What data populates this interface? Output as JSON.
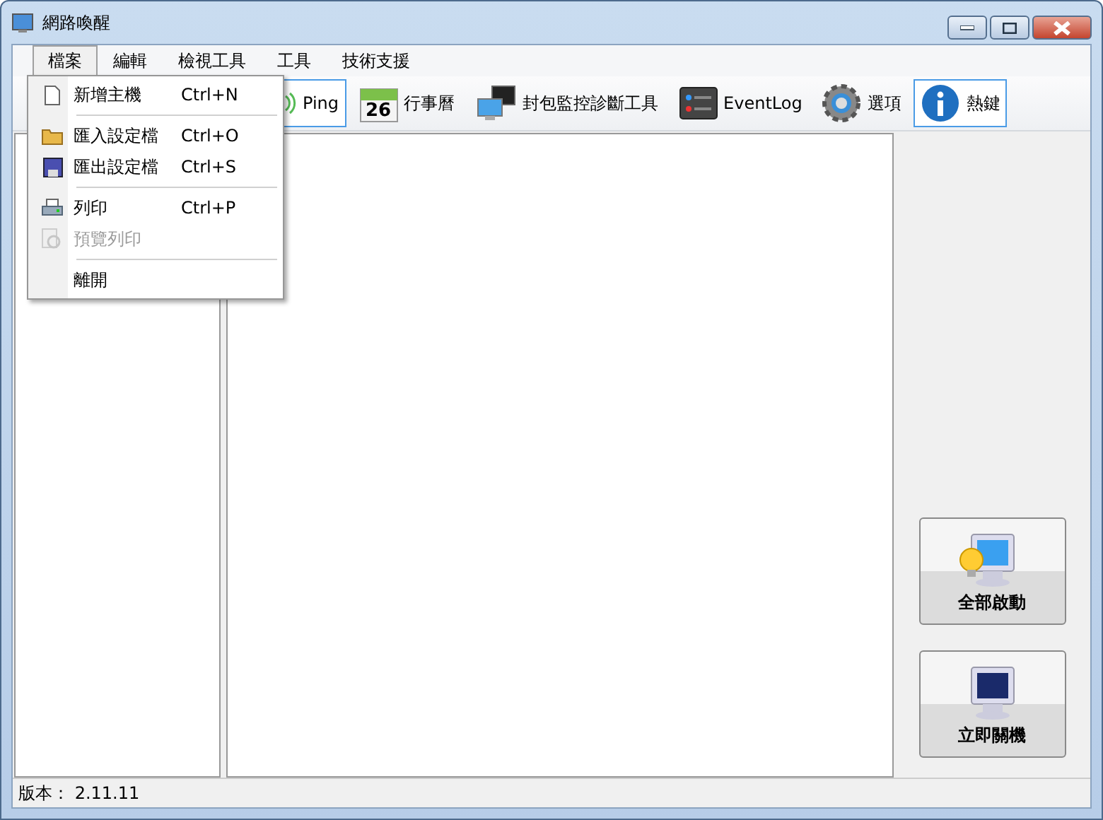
{
  "window": {
    "title": "網路喚醒"
  },
  "menu": [
    {
      "label": "檔案",
      "selected": true
    },
    {
      "label": "編輯",
      "selected": false
    },
    {
      "label": "檢視工具",
      "selected": false
    },
    {
      "label": "工具",
      "selected": false
    },
    {
      "label": "技術支援",
      "selected": false
    }
  ],
  "dropdown": [
    {
      "kind": "item",
      "label": "新增主機",
      "shortcut": "Ctrl+N",
      "disabled": false
    },
    {
      "kind": "separator"
    },
    {
      "kind": "item",
      "label": "匯入設定檔",
      "shortcut": "Ctrl+O",
      "disabled": false
    },
    {
      "kind": "item",
      "label": "匯出設定檔",
      "shortcut": "Ctrl+S",
      "disabled": false
    },
    {
      "kind": "separator"
    },
    {
      "kind": "item",
      "label": "列印",
      "shortcut": "Ctrl+P",
      "disabled": false
    },
    {
      "kind": "item",
      "label": "預覽列印",
      "disabled": true
    },
    {
      "kind": "separator"
    },
    {
      "kind": "item",
      "label": "離開",
      "disabled": false
    }
  ],
  "toolbar": [
    {
      "label": "Ping",
      "selected": true
    },
    {
      "icon_text": "26",
      "label": "行事曆",
      "selected": false
    },
    {
      "label": "封包監控診斷工具",
      "selected": false
    },
    {
      "label": "EventLog",
      "selected": false
    },
    {
      "label": "選項",
      "selected": false
    },
    {
      "label": "熱鍵",
      "selected": true
    }
  ],
  "actions": [
    {
      "label": "全部啟動"
    },
    {
      "label": "立即關機"
    }
  ],
  "status_bar": {
    "version": "版本： 2.11.11"
  }
}
